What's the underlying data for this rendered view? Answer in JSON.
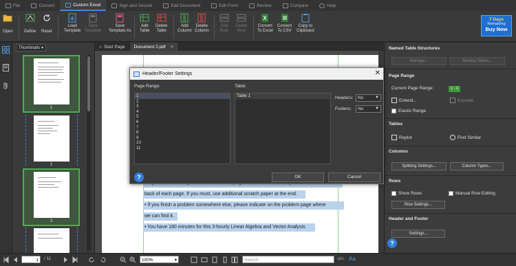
{
  "menubar": {
    "items": [
      {
        "label": "File",
        "icon": "file-icon",
        "active": false
      },
      {
        "label": "Convert",
        "icon": "convert-icon",
        "active": false
      },
      {
        "label": "Custom Excel",
        "icon": "custom-excel-icon",
        "active": true
      },
      {
        "label": "Sign and Secure",
        "icon": "sign-secure-icon",
        "active": false
      },
      {
        "label": "Edit Document",
        "icon": "edit-document-icon",
        "active": false
      },
      {
        "label": "Edit Form",
        "icon": "edit-form-icon",
        "active": false
      },
      {
        "label": "Review",
        "icon": "review-icon",
        "active": false
      },
      {
        "label": "Compare",
        "icon": "compare-icon",
        "active": false
      },
      {
        "label": "Help",
        "icon": "help-icon",
        "active": false
      }
    ]
  },
  "toolbar": {
    "open": "Open",
    "define": "Define",
    "reset": "Reset",
    "load_template": [
      "Load",
      "Template"
    ],
    "save_template": [
      "Save",
      "Template"
    ],
    "save_template_as": [
      "Save",
      "Template As"
    ],
    "add_table": [
      "Add",
      "Table"
    ],
    "delete_table": [
      "Delete",
      "Table"
    ],
    "add_column": [
      "Add",
      "Column"
    ],
    "delete_column": [
      "Delete",
      "Column"
    ],
    "add_row": [
      "Add",
      "Row"
    ],
    "delete_row": [
      "Delete",
      "Row"
    ],
    "convert_excel": [
      "Convert",
      "To Excel"
    ],
    "convert_csv": [
      "Convert",
      "To CSV"
    ],
    "copy_clipboard": [
      "Copy to",
      "Clipboard"
    ]
  },
  "promo": {
    "line1": "7 Days",
    "line2": "Remaining",
    "line3": "Buy Now"
  },
  "thumbnails": {
    "dropdown": "Thumbnails",
    "pages": [
      "1",
      "2",
      "3"
    ]
  },
  "tabs": [
    {
      "label": "Start Page"
    },
    {
      "label": "Document 2.pdf"
    }
  ],
  "document": {
    "lines": [
      "• Try to answer the question on the same page. There is additional space on the",
      "back of each page. If you must, use additional scratch paper at the end.",
      "• If you finish a problem somewhere else, please indicate on the problem page where",
      "we can find it.",
      "• You have 180 minutes for this 3-hourly Linear Algebra and Vector Analysis"
    ]
  },
  "right_panel": {
    "named_structures": "Named Table Structures",
    "manage": "Manage...",
    "review_tables": "Review Tables...",
    "page_range": "Page Range",
    "current_page_range_label": "Current Page Range:",
    "current_page_range_value": "1 - 1",
    "extend": "Extend...",
    "exclude": "Exclude",
    "elastic_range": "Elastic Range",
    "tables": "Tables",
    "replot": "Replot",
    "find_similar": "Find Similar",
    "columns": "Columns",
    "splitting_settings": "Splitting Settings...",
    "column_types": "Column Types...",
    "rows": "Rows",
    "show_rows": "Show Rows",
    "manual_row_editing": "Manual Row Editing",
    "row_settings": "Row Settings...",
    "header_footer": "Header and Footer",
    "settings": "Settings..."
  },
  "dialog": {
    "title": "Header/Footer Settings",
    "page_range_label": "Page Range:",
    "page_range_items": [
      "1",
      "2",
      "3",
      "4",
      "5",
      "6",
      "7",
      "8",
      "9",
      "10",
      "11"
    ],
    "table_label": "Table:",
    "table_items": [
      "Table 1"
    ],
    "headers_label": "Headers:",
    "headers_value": "No",
    "footers_label": "Footers:",
    "footers_value": "No",
    "ok": "OK",
    "cancel": "Cancel"
  },
  "statusbar": {
    "current_page": "1",
    "total_pages": "/ 11",
    "zoom": "100%",
    "search_placeholder": "Search",
    "abc": "abc",
    "aa": "Aa"
  },
  "colors": {
    "accent": "#3e8bd6",
    "selection_green": "#4caf50",
    "highlight": "#b9d3ec",
    "promo": "#1f6fd0"
  }
}
